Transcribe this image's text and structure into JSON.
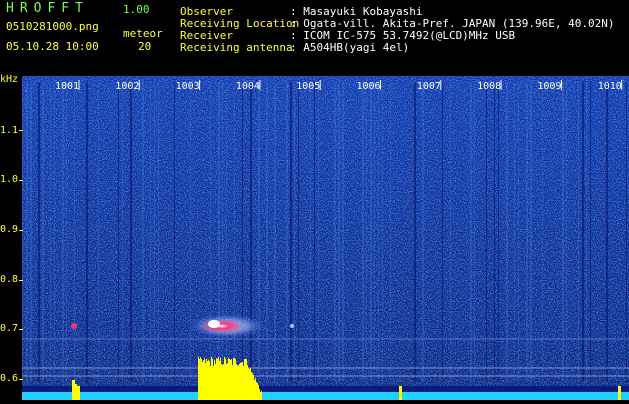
{
  "app": {
    "name": "HROFFT",
    "version": "1.00"
  },
  "file": {
    "name": "0510281000.png",
    "datetime": "05.10.28 10:00"
  },
  "meteor": {
    "label": "meteor",
    "count": "20"
  },
  "info": [
    {
      "key": "Observer",
      "value": ": Masayuki Kobayashi"
    },
    {
      "key": "Receiving Location",
      "value": ": Ogata-vill. Akita-Pref. JAPAN (139.96E, 40.02N)"
    },
    {
      "key": "Receiver",
      "value": ": ICOM IC-575 53.7492(@LCD)MHz USB"
    },
    {
      "key": "Receiving antenna",
      "value": ": A504HB(yagi 4el)"
    }
  ],
  "axis": {
    "unit": "kHz",
    "ticks": [
      "1.1",
      "1.0",
      "0.9",
      "0.8",
      "0.7",
      "0.6"
    ],
    "time_labels": [
      "1001",
      "1002",
      "1003",
      "1004",
      "1005",
      "1006",
      "1007",
      "1008",
      "1009",
      "1010"
    ]
  },
  "colors": {
    "background": "#000000",
    "spectrum_base": "#0a1e8c",
    "noise_high": "#38b0ff",
    "echo_core": "#ff2d7d",
    "echo_halo": "#f0f0ff",
    "level_bar": "#ffff00",
    "level_floor": "#20d0ff",
    "label_yellow": "#ffff40",
    "label_green": "#7cff4a"
  }
}
